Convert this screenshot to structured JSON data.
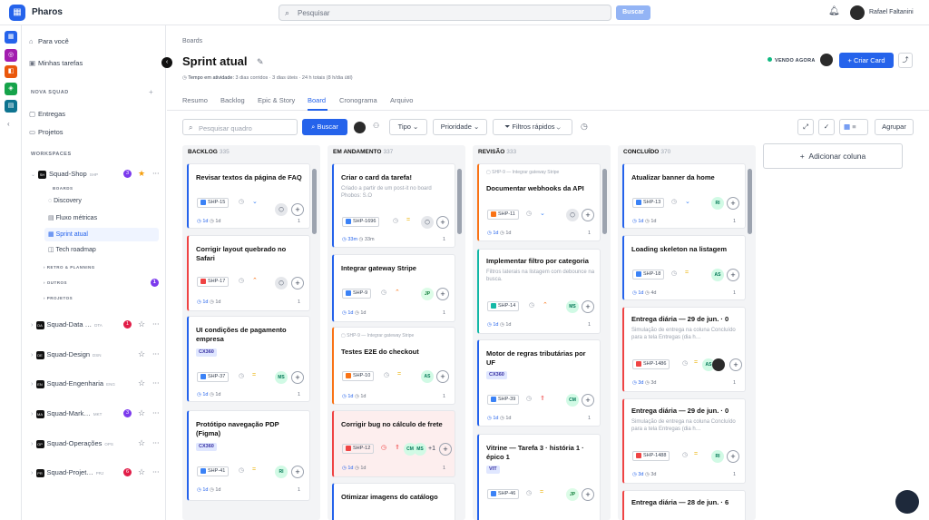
{
  "app": {
    "name": "Pharos",
    "search_placeholder": "Pesquisar",
    "search_button": "Buscar",
    "user_name": "Rafael Faltanini"
  },
  "sidebar": {
    "items": [
      {
        "label": "Para você"
      },
      {
        "label": "Minhas tarefas"
      }
    ],
    "section_new_squad": "NOVA SQUAD",
    "squad_items": [
      {
        "label": "Entregas"
      },
      {
        "label": "Projetos"
      }
    ],
    "section_workspaces": "WORKSPACES",
    "squad_shop": {
      "name": "Squad-Shop",
      "code": "SH",
      "abbr": "SHP",
      "badge": "3"
    },
    "boards_label": "BOARDS",
    "boards": [
      {
        "label": "Discovery"
      },
      {
        "label": "Fluxo métricas"
      },
      {
        "label": "Sprint atual"
      },
      {
        "label": "Tech roadmap"
      }
    ],
    "groups": [
      {
        "label": "RETRO & PLANNING"
      },
      {
        "label": "OUTROS",
        "badge": "1"
      },
      {
        "label": "PROJETOS"
      }
    ],
    "squads": [
      {
        "name": "Squad-Data …",
        "code": "DA",
        "abbr": "DTA",
        "badge": "1"
      },
      {
        "name": "Squad-Design",
        "code": "DE",
        "abbr": "DSN",
        "badge": ""
      },
      {
        "name": "Squad-Engenharia",
        "code": "EN",
        "abbr": "ENG",
        "badge": ""
      },
      {
        "name": "Squad-Mark…",
        "code": "MA",
        "abbr": "MKT",
        "badge": "3"
      },
      {
        "name": "Squad-Operações",
        "code": "OP",
        "abbr": "OPS",
        "badge": ""
      },
      {
        "name": "Squad-Projet…",
        "code": "PR",
        "abbr": "PRJ",
        "badge": "6"
      }
    ]
  },
  "main": {
    "breadcrumb": "Boards",
    "title": "Sprint atual",
    "meta_label": "Tempo em atividade:",
    "meta_value": "3 dias corridos · 3 dias úteis · 24 h totais (8 h/dia útil)",
    "viewing": "VENDO AGORA",
    "new_card": "Criar Card",
    "tabs": [
      {
        "label": "Resumo"
      },
      {
        "label": "Backlog"
      },
      {
        "label": "Epic & Story"
      },
      {
        "label": "Board"
      },
      {
        "label": "Cronograma"
      },
      {
        "label": "Arquivo"
      }
    ],
    "filter_placeholder": "Pesquisar quadro",
    "filter_search": "Buscar",
    "filter_type": "Tipo",
    "filter_priority": "Prioridade",
    "filter_quick": "Filtros rápidos",
    "group_button": "Agrupar",
    "add_column": "Adicionar coluna"
  },
  "columns": [
    {
      "name": "BACKLOG",
      "count": "335",
      "cards": [
        {
          "title": "Revisar textos da página de FAQ",
          "id": "SHP-15",
          "footer_a": "1d",
          "footer_b": "1d",
          "num": "1"
        },
        {
          "title": "Corrigir layout quebrado no Safari",
          "id": "SHP-17",
          "footer_a": "1d",
          "footer_b": "1d",
          "num": "1"
        },
        {
          "title": "UI condições de pagamento empresa",
          "tag": "CX360",
          "id": "SHP-37",
          "assignee": "MS",
          "footer_a": "1d",
          "footer_b": "1d",
          "num": "1"
        },
        {
          "title": "Protótipo navegação PDP (Figma)",
          "tag": "CX360",
          "id": "SHP-41",
          "assignee": "RI",
          "footer_a": "1d",
          "footer_b": "1d",
          "num": "1"
        }
      ]
    },
    {
      "name": "EM ANDAMENTO",
      "count": "337",
      "cards": [
        {
          "title": "Criar o card da tarefa!",
          "desc": "Criado a partir de um post-it no board Phobos: S.O",
          "id": "SHP-1696",
          "footer_a": "33m",
          "footer_b": "33m",
          "num": "1"
        },
        {
          "title": "Integrar gateway Stripe",
          "id": "SHP-9",
          "assignee": "JP",
          "footer_a": "1d",
          "footer_b": "1d",
          "num": "1"
        },
        {
          "pre": "SHP-9 — Integrar gateway Stripe",
          "title": "Testes E2E do checkout",
          "id": "SHP-10",
          "assignee": "AS",
          "footer_a": "1d",
          "footer_b": "1d",
          "num": "1"
        },
        {
          "title": "Corrigir bug no cálculo de frete",
          "id": "SHP-12",
          "assignee": "CM",
          "assignee2": "MS",
          "extra": "+1",
          "footer_a": "1d",
          "footer_b": "1d",
          "num": "1"
        },
        {
          "title": "Otimizar imagens do catálogo"
        }
      ]
    },
    {
      "name": "REVISÃO",
      "count": "333",
      "cards": [
        {
          "pre": "SHP-9 — Integrar gateway Stripe",
          "title": "Documentar webhooks da API",
          "id": "SHP-11",
          "footer_a": "1d",
          "footer_b": "1d",
          "num": "1"
        },
        {
          "title": "Implementar filtro por categoria",
          "desc": "Filtros laterais na listagem com debounce na busca.",
          "id": "SHP-14",
          "assignee": "MS",
          "footer_a": "1d",
          "footer_b": "1d",
          "num": "1"
        },
        {
          "title": "Motor de regras tributárias por UF",
          "tag": "CX360",
          "id": "SHP-39",
          "assignee": "CM",
          "footer_a": "1d",
          "footer_b": "1d",
          "num": "1"
        },
        {
          "title": "Vitrine — Tarefa 3 · história 1 · épico 1",
          "tag": "VIT",
          "id": "SHP-46",
          "assignee": "JP"
        }
      ]
    },
    {
      "name": "CONCLUÍDO",
      "count": "370",
      "cards": [
        {
          "title": "Atualizar banner da home",
          "id": "SHP-13",
          "assignee": "RI",
          "footer_a": "1d",
          "footer_b": "1d",
          "num": "1"
        },
        {
          "title": "Loading skeleton na listagem",
          "id": "SHP-18",
          "assignee": "AS",
          "footer_a": "1d",
          "footer_b": "4d",
          "num": "1"
        },
        {
          "title": "Entrega diária — 29 de jun. · 0",
          "desc": "Simulação de entrega na coluna Concluído para a tela Entregas (dia h…",
          "id": "SHP-1486",
          "assignee": "AS",
          "footer_a": "3d",
          "footer_b": "3d",
          "num": "1"
        },
        {
          "title": "Entrega diária — 29 de jun. · 0",
          "desc": "Simulação de entrega na coluna Concluído para a tela Entregas (dia h…",
          "id": "SHP-1488",
          "assignee": "RI",
          "footer_a": "3d",
          "footer_b": "3d",
          "num": "1"
        },
        {
          "title": "Entrega diária — 28 de jun. · 6"
        }
      ]
    }
  ],
  "colors": {
    "accent": "#2563eb",
    "background": "#ffffff",
    "column": "#f3f4f6"
  }
}
